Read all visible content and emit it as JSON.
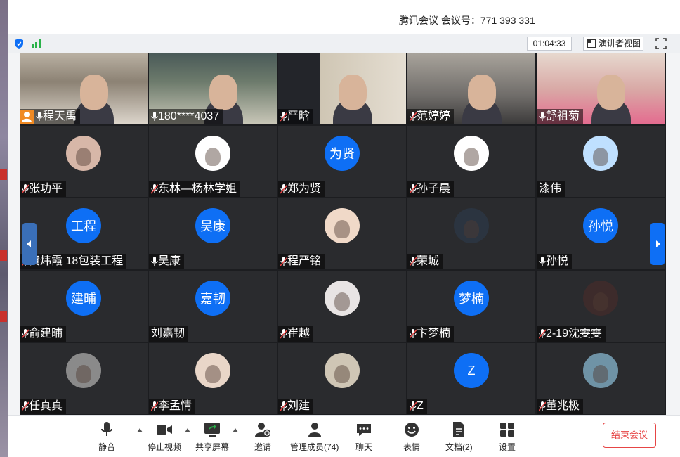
{
  "window": {
    "title": "腾讯会议 会议号：771 393 331"
  },
  "toolbar": {
    "timer": "01:04:33",
    "speaker_view": "演讲者视图"
  },
  "tiles": [
    {
      "name": "程天禹",
      "mic": "on",
      "host": true,
      "kind": "video"
    },
    {
      "name": "180****4037",
      "mic": "on",
      "kind": "video",
      "active": true
    },
    {
      "name": "严晗",
      "mic": "muted",
      "kind": "video"
    },
    {
      "name": "范婷婷",
      "mic": "muted",
      "kind": "video"
    },
    {
      "name": "舒祖菊",
      "mic": "on",
      "kind": "video"
    },
    {
      "name": "张功平",
      "mic": "muted",
      "kind": "image",
      "avatar_icon": "cartoon-pair-avatar"
    },
    {
      "name": "东林—杨林学姐",
      "mic": "muted",
      "kind": "image",
      "avatar_icon": "bunny-avatar"
    },
    {
      "name": "郑为贤",
      "mic": "muted",
      "kind": "text",
      "avatar_text": "为贤"
    },
    {
      "name": "孙子晨",
      "mic": "muted",
      "kind": "image",
      "avatar_icon": "cartoon-reader-avatar"
    },
    {
      "name": "漆伟",
      "mic": "none",
      "kind": "image",
      "avatar_icon": "crayon-shin-avatar"
    },
    {
      "name": "黄炜霞 18包装工程",
      "mic": "muted",
      "kind": "text",
      "avatar_text": "工程"
    },
    {
      "name": "吴康",
      "mic": "on",
      "kind": "text",
      "avatar_text": "吴康"
    },
    {
      "name": "程严铭",
      "mic": "muted",
      "kind": "image",
      "avatar_icon": "girl-portrait-avatar"
    },
    {
      "name": "荣城",
      "mic": "muted",
      "kind": "image",
      "avatar_icon": "moon-avatar"
    },
    {
      "name": "孙悦",
      "mic": "on",
      "kind": "text",
      "avatar_text": "孙悦"
    },
    {
      "name": "俞建晡",
      "mic": "muted",
      "kind": "text",
      "avatar_text": "建晡"
    },
    {
      "name": "刘嘉韧",
      "mic": "none",
      "kind": "text",
      "avatar_text": "嘉韧"
    },
    {
      "name": "崔越",
      "mic": "muted",
      "kind": "image",
      "avatar_icon": "girl-face-avatar"
    },
    {
      "name": "卞梦楠",
      "mic": "muted",
      "kind": "text",
      "avatar_text": "梦楠"
    },
    {
      "name": "2-19沈雯雯",
      "mic": "muted",
      "kind": "image",
      "avatar_icon": "doll-avatar"
    },
    {
      "name": "任真真",
      "mic": "muted",
      "kind": "image",
      "avatar_icon": "bw-girl-avatar"
    },
    {
      "name": "李孟情",
      "mic": "muted",
      "kind": "image",
      "avatar_icon": "child-avatar"
    },
    {
      "name": "刘建",
      "mic": "muted",
      "kind": "image",
      "avatar_icon": "standing-person-avatar"
    },
    {
      "name": "Z",
      "mic": "muted",
      "kind": "text",
      "avatar_text": "Z"
    },
    {
      "name": "董兆极",
      "mic": "muted",
      "kind": "image",
      "avatar_icon": "landscape-avatar"
    }
  ],
  "controls": {
    "mute": "静音",
    "stop_video": "停止视频",
    "share_screen": "共享屏幕",
    "invite": "邀请",
    "manage_members": "管理成员(74)",
    "chat": "聊天",
    "reactions": "表情",
    "documents": "文档(2)",
    "settings": "设置",
    "end_meeting": "结束会议"
  },
  "colors": {
    "accent": "#0e6ff5",
    "active_speaker": "#28b463",
    "danger": "#e64545",
    "host_badge": "#f08a24"
  }
}
